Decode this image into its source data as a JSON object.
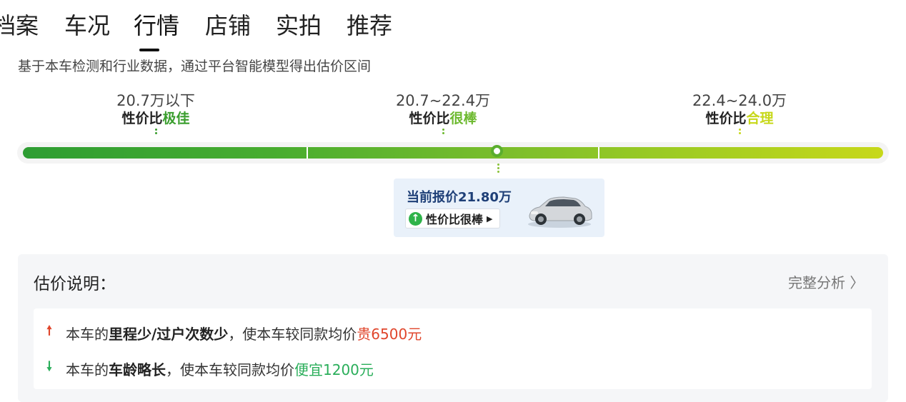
{
  "tabs": [
    {
      "label": "档案"
    },
    {
      "label": "车况"
    },
    {
      "label": "行情"
    },
    {
      "label": "店铺"
    },
    {
      "label": "实拍"
    },
    {
      "label": "推荐"
    }
  ],
  "subtitle": "基于本车检测和行业数据，通过平台智能模型得出估价区间",
  "segments": [
    {
      "range": "20.7万以下",
      "rating_prefix": "性价比",
      "rating_word": "极佳",
      "color": "#3a9e2e"
    },
    {
      "range": "20.7~22.4万",
      "rating_prefix": "性价比",
      "rating_word": "很棒",
      "color": "#6cb92e"
    },
    {
      "range": "22.4~24.0万",
      "rating_prefix": "性价比",
      "rating_word": "合理",
      "color": "#c7d81a"
    }
  ],
  "current": {
    "label": "当前报价21.80万",
    "badge": "性价比很棒",
    "position_fraction": 0.55
  },
  "explanation": {
    "title": "估价说明：",
    "link": "完整分析 〉",
    "rows": [
      {
        "pre": "本车的",
        "bold": "里程少/过户次数少",
        "mid": "，使本车较同款均价",
        "delta": "贵6500元",
        "direction": "up"
      },
      {
        "pre": "本车的",
        "bold": "车龄略长",
        "mid": "，使本车较同款均价",
        "delta": "便宜1200元",
        "direction": "down"
      }
    ]
  }
}
